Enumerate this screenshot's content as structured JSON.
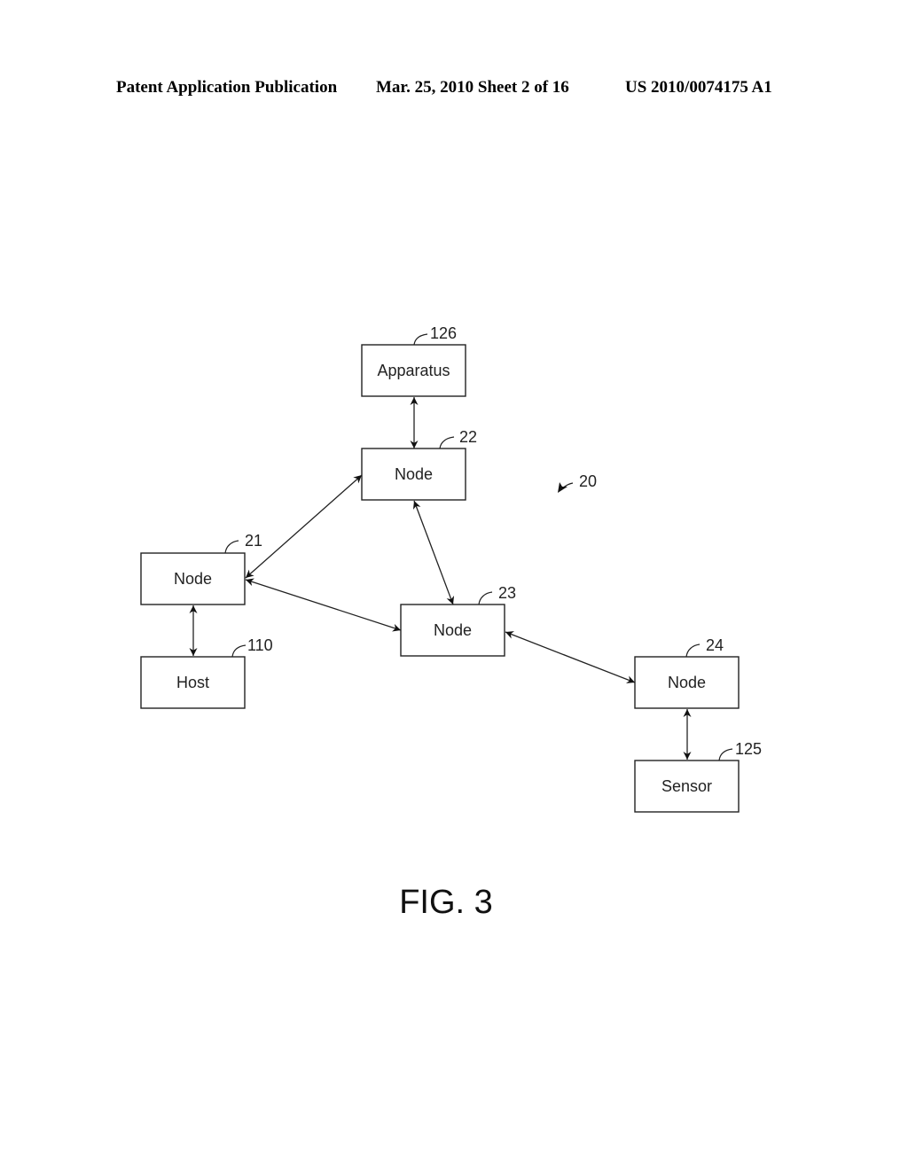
{
  "header": {
    "publication_type": "Patent Application Publication",
    "date_sheet": "Mar. 25, 2010  Sheet 2 of 16",
    "publication_number": "US 2010/0074175 A1"
  },
  "figure": {
    "caption": "FIG. 3",
    "system_ref": "20",
    "nodes": [
      {
        "id": "apparatus",
        "label": "Apparatus",
        "ref": "126"
      },
      {
        "id": "node22",
        "label": "Node",
        "ref": "22"
      },
      {
        "id": "node21",
        "label": "Node",
        "ref": "21"
      },
      {
        "id": "host",
        "label": "Host",
        "ref": "110"
      },
      {
        "id": "node23",
        "label": "Node",
        "ref": "23"
      },
      {
        "id": "node24",
        "label": "Node",
        "ref": "24"
      },
      {
        "id": "sensor",
        "label": "Sensor",
        "ref": "125"
      }
    ],
    "edges": [
      {
        "from": "apparatus",
        "to": "node22",
        "direction": "bidirectional"
      },
      {
        "from": "node21",
        "to": "node22",
        "direction": "bidirectional"
      },
      {
        "from": "node22",
        "to": "node23",
        "direction": "bidirectional"
      },
      {
        "from": "node21",
        "to": "node23",
        "direction": "bidirectional"
      },
      {
        "from": "node21",
        "to": "host",
        "direction": "bidirectional"
      },
      {
        "from": "node23",
        "to": "node24",
        "direction": "bidirectional"
      },
      {
        "from": "node24",
        "to": "sensor",
        "direction": "bidirectional"
      }
    ]
  }
}
